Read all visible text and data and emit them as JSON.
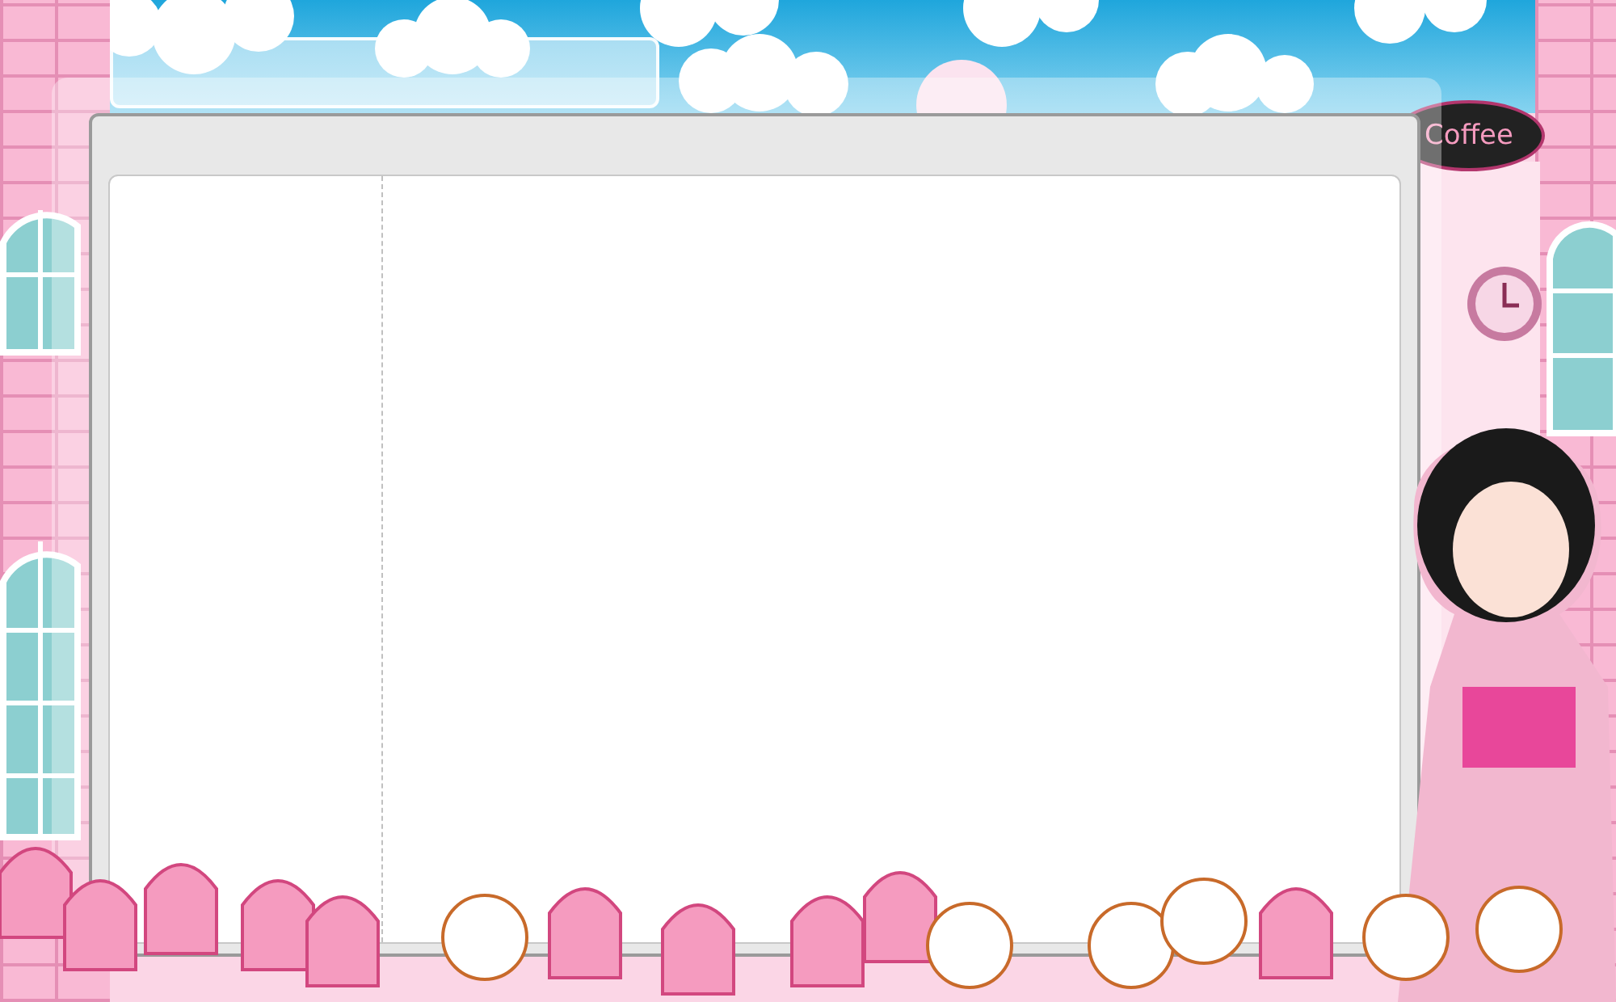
{
  "shop_sign": {
    "text": "Coffee"
  }
}
